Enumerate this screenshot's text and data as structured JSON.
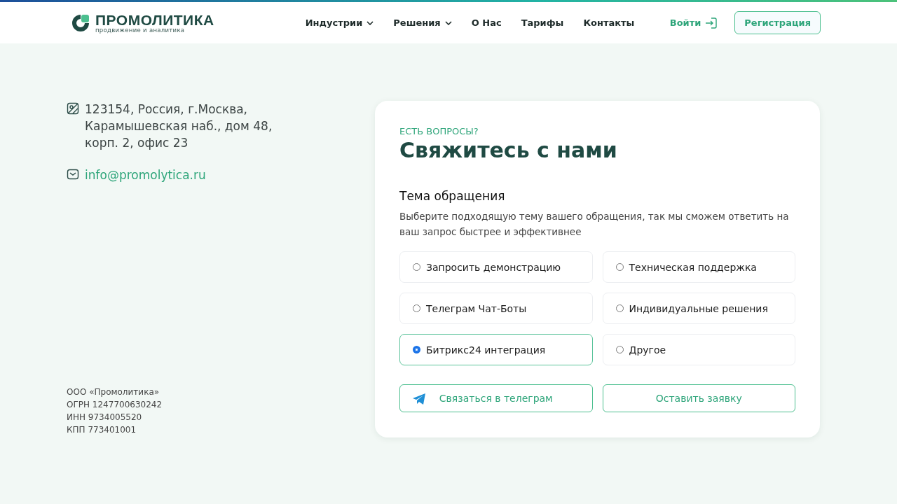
{
  "header": {
    "logo": {
      "name": "ПРОМОЛИТИКА",
      "tagline": "продвижение и аналитика"
    },
    "nav": [
      {
        "label": "Индустрии",
        "dropdown": true
      },
      {
        "label": "Решения",
        "dropdown": true
      },
      {
        "label": "О Нас",
        "dropdown": false
      },
      {
        "label": "Тарифы",
        "dropdown": false
      },
      {
        "label": "Контакты",
        "dropdown": false
      }
    ],
    "login": "Войти",
    "register": "Регистрация"
  },
  "contacts": {
    "address": "123154, Россия, г.Москва, Карамышевская наб., дом 48, корп. 2, офис 23",
    "email": "info@promolytica.ru"
  },
  "company": [
    "ООО «Промолитика»",
    "ОГРН 1247700630242",
    "ИНН 9734005520",
    "КПП 773401001"
  ],
  "form": {
    "eyebrow": "ЕСТЬ ВОПРОСЫ?",
    "title": "Свяжитесь с нами",
    "topic_title": "Тема обращения",
    "topic_hint": "Выберите подходящую тему вашего обращения, так мы сможем ответить  на ваш запрос быстрее и эффективнее",
    "options": [
      {
        "label": "Запросить демонстрацию",
        "selected": false
      },
      {
        "label": "Техническая поддержка",
        "selected": false
      },
      {
        "label": "Телеграм Чат-Боты",
        "selected": false
      },
      {
        "label": "Индивидуальные решения",
        "selected": false
      },
      {
        "label": "Битрикс24 интеграция",
        "selected": true
      },
      {
        "label": "Другое",
        "selected": false
      }
    ],
    "buttons": [
      {
        "label": "Связаться в телеграм",
        "kind": "telegram"
      },
      {
        "label": "Оставить заявку",
        "kind": "plain"
      }
    ]
  }
}
